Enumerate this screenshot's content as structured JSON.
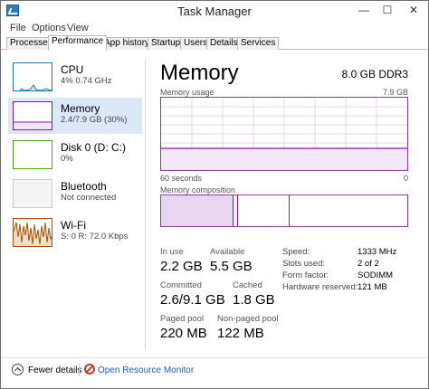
{
  "window": {
    "title": "Task Manager",
    "controls": {
      "minimize": "—",
      "maximize": "☐",
      "close": "✕"
    }
  },
  "menu": {
    "file": "File",
    "options": "Options",
    "view": "View"
  },
  "tabs": [
    "Processes",
    "Performance",
    "App history",
    "Startup",
    "Users",
    "Details",
    "Services"
  ],
  "sidebar": {
    "items": [
      {
        "title": "CPU",
        "subtitle": "4% 0.74 GHz",
        "color": "#117dbb"
      },
      {
        "title": "Memory",
        "subtitle": "2.4/7.9 GB (30%)",
        "color": "#8b12ae"
      },
      {
        "title": "Disk 0 (D: C:)",
        "subtitle": "0%",
        "color": "#4da60c"
      },
      {
        "title": "Bluetooth",
        "subtitle": "Not connected",
        "color": "#cccccc"
      },
      {
        "title": "Wi-Fi",
        "subtitle": "S: 0  R: 72.0 Kbps",
        "color": "#a74f01"
      }
    ]
  },
  "main": {
    "title": "Memory",
    "spec": "8.0 GB DDR3",
    "usage_label": "Memory usage",
    "usage_max": "7.9 GB",
    "time_label": "60 seconds",
    "time_zero": "0",
    "composition_label": "Memory composition",
    "accent": "#8b12ae",
    "stats": {
      "in_use_label": "In use",
      "in_use": "2.2 GB",
      "available_label": "Available",
      "available": "5.5 GB",
      "committed_label": "Committed",
      "committed": "2.6/9.1 GB",
      "cached_label": "Cached",
      "cached": "1.8 GB",
      "paged_label": "Paged pool",
      "paged": "220 MB",
      "nonpaged_label": "Non-paged pool",
      "nonpaged": "122 MB"
    },
    "details": {
      "speed_label": "Speed:",
      "speed": "1333 MHz",
      "slots_label": "Slots used:",
      "slots": "2 of 2",
      "form_label": "Form factor:",
      "form": "SODIMM",
      "reserved_label": "Hardware reserved:",
      "reserved": "121 MB"
    }
  },
  "footer": {
    "fewer": "Fewer details",
    "open_rm": "Open Resource Monitor"
  }
}
